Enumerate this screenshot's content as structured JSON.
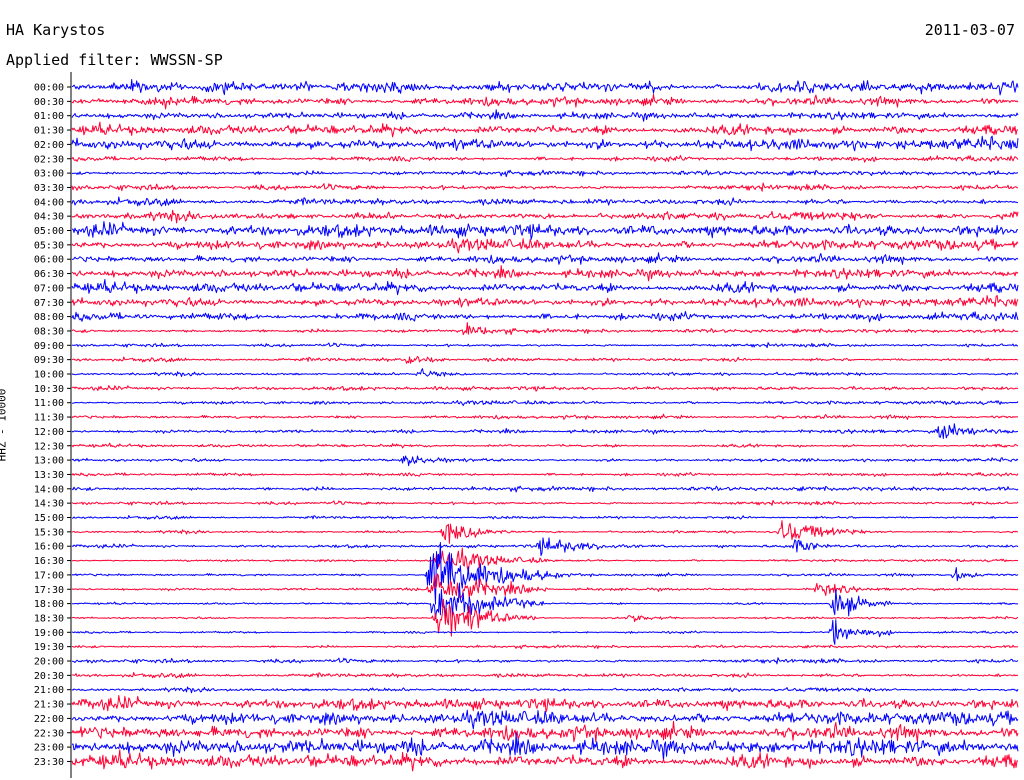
{
  "header": {
    "station": "HA Karystos",
    "date": "2011-03-07",
    "filter": "Applied filter: WWSSN-SP"
  },
  "chart_data": {
    "type": "line",
    "title": "HA Karystos",
    "ylabel": "HHZ - 10000",
    "x_range_minutes": [
      0,
      30
    ],
    "row_labels": [
      "00:00",
      "00:30",
      "01:00",
      "01:30",
      "02:00",
      "02:30",
      "03:00",
      "03:30",
      "04:00",
      "04:30",
      "05:00",
      "05:30",
      "06:00",
      "06:30",
      "07:00",
      "07:30",
      "08:00",
      "08:30",
      "09:00",
      "09:30",
      "10:00",
      "10:30",
      "11:00",
      "11:30",
      "12:00",
      "12:30",
      "13:00",
      "13:30",
      "14:00",
      "14:30",
      "15:00",
      "15:30",
      "16:00",
      "16:30",
      "17:00",
      "17:30",
      "18:00",
      "18:30",
      "19:00",
      "19:30",
      "20:00",
      "20:30",
      "21:00",
      "21:30",
      "22:00",
      "22:30",
      "23:00",
      "23:30"
    ],
    "series_colors": [
      "#0000ff",
      "#ff0033"
    ],
    "color_pattern": "alternating",
    "noise_level_by_row": [
      2.5,
      2.2,
      1.6,
      2.6,
      2.8,
      1.4,
      1.2,
      1.5,
      1.6,
      2.4,
      2.9,
      2.6,
      2.0,
      2.1,
      2.6,
      2.3,
      2.2,
      1.0,
      0.9,
      0.9,
      0.9,
      0.9,
      0.9,
      0.9,
      0.8,
      0.8,
      0.8,
      0.9,
      1.1,
      0.9,
      0.7,
      0.8,
      0.7,
      0.6,
      0.7,
      0.6,
      0.5,
      0.5,
      0.6,
      0.7,
      1.1,
      1.0,
      1.1,
      2.6,
      3.4,
      3.6,
      3.8,
      3.6
    ],
    "events": [
      {
        "row": 33,
        "minute": 11.8,
        "amplitude": 9,
        "duration_min": 1.3
      },
      {
        "row": 34,
        "minute": 11.6,
        "amplitude": 22,
        "duration_min": 1.6
      },
      {
        "row": 35,
        "minute": 11.6,
        "amplitude": 14,
        "duration_min": 1.4
      },
      {
        "row": 36,
        "minute": 11.7,
        "amplitude": 18,
        "duration_min": 1.3
      },
      {
        "row": 37,
        "minute": 11.7,
        "amplitude": 16,
        "duration_min": 1.2
      },
      {
        "row": 31,
        "minute": 11.9,
        "amplitude": 7,
        "duration_min": 0.9
      },
      {
        "row": 32,
        "minute": 15.0,
        "amplitude": 6,
        "duration_min": 1.2
      },
      {
        "row": 31,
        "minute": 22.6,
        "amplitude": 8,
        "duration_min": 1.0
      },
      {
        "row": 32,
        "minute": 22.9,
        "amplitude": 6,
        "duration_min": 0.6
      },
      {
        "row": 35,
        "minute": 23.7,
        "amplitude": 6,
        "duration_min": 0.6
      },
      {
        "row": 36,
        "minute": 24.2,
        "amplitude": 10,
        "duration_min": 0.8
      },
      {
        "row": 38,
        "minute": 24.2,
        "amplitude": 8,
        "duration_min": 0.8
      },
      {
        "row": 24,
        "minute": 27.6,
        "amplitude": 6,
        "duration_min": 1.0
      },
      {
        "row": 34,
        "minute": 28.0,
        "amplitude": 5,
        "duration_min": 0.5
      },
      {
        "row": 20,
        "minute": 11.0,
        "amplitude": 4,
        "duration_min": 0.5
      },
      {
        "row": 17,
        "minute": 12.5,
        "amplitude": 4,
        "duration_min": 0.6
      },
      {
        "row": 19,
        "minute": 10.7,
        "amplitude": 4,
        "duration_min": 0.5
      },
      {
        "row": 26,
        "minute": 10.6,
        "amplitude": 5,
        "duration_min": 0.7
      },
      {
        "row": 37,
        "minute": 17.7,
        "amplitude": 4,
        "duration_min": 0.6
      }
    ]
  }
}
